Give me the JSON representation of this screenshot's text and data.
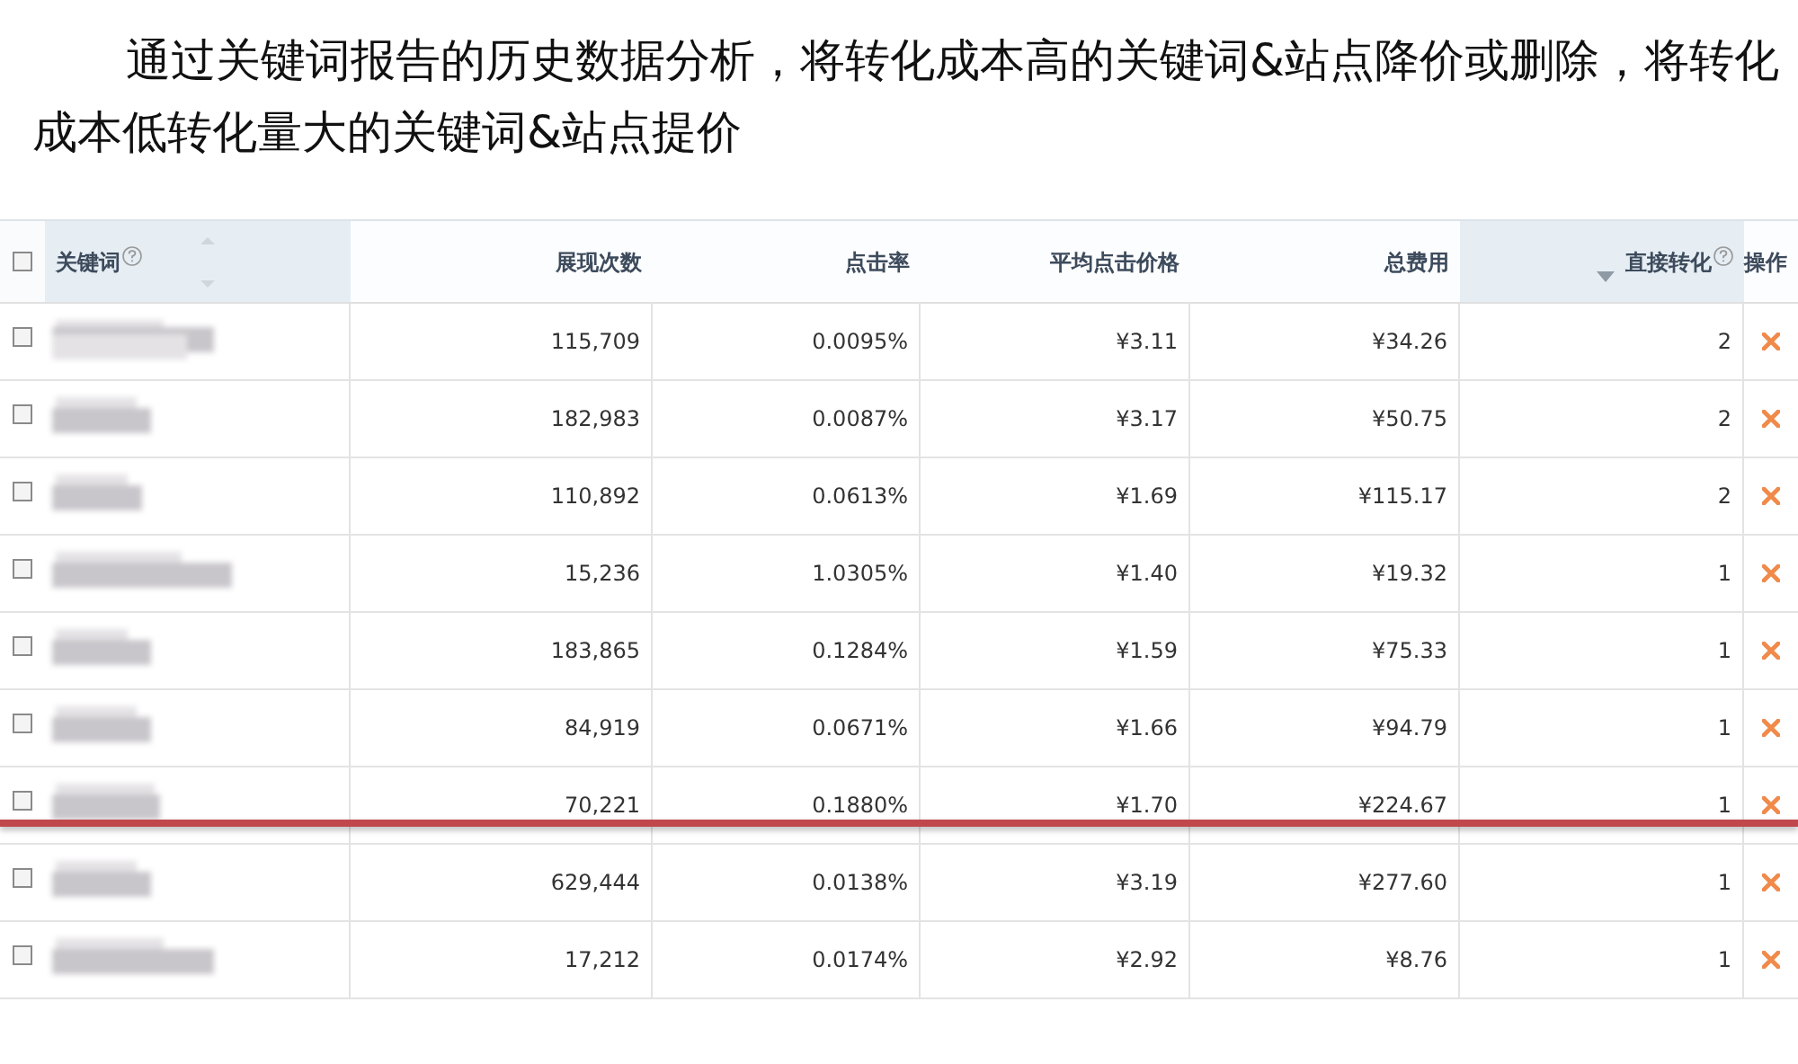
{
  "caption": "通过关键词报告的历史数据分析，将转化成本高的关键词&站点降价或删除，将转化成本低转化量大的关键词&站点提价",
  "table": {
    "select_all_checked": false,
    "columns": [
      {
        "label": "关键词",
        "help": true,
        "sortable": true,
        "sorted": false,
        "highlighted": true
      },
      {
        "label": "展现次数",
        "help": false,
        "sortable": false,
        "sorted": false,
        "highlighted": false
      },
      {
        "label": "点击率",
        "help": false,
        "sortable": false,
        "sorted": false,
        "highlighted": false
      },
      {
        "label": "平均点击价格",
        "help": false,
        "sortable": false,
        "sorted": false,
        "highlighted": false
      },
      {
        "label": "总费用",
        "help": false,
        "sortable": false,
        "sorted": false,
        "highlighted": false
      },
      {
        "label": "直接转化",
        "help": true,
        "sortable": false,
        "sorted": true,
        "highlighted": true
      },
      {
        "label": "操作",
        "help": false,
        "sortable": false,
        "sorted": false,
        "highlighted": false
      }
    ],
    "rows": [
      {
        "checked": false,
        "underlined": false,
        "cells": [
          "",
          "115,709",
          "0.0095%",
          "¥3.11",
          "¥34.26",
          "2"
        ]
      },
      {
        "checked": false,
        "underlined": false,
        "cells": [
          "",
          "182,983",
          "0.0087%",
          "¥3.17",
          "¥50.75",
          "2"
        ]
      },
      {
        "checked": false,
        "underlined": false,
        "cells": [
          "",
          "110,892",
          "0.0613%",
          "¥1.69",
          "¥115.17",
          "2"
        ]
      },
      {
        "checked": false,
        "underlined": false,
        "cells": [
          "",
          "15,236",
          "1.0305%",
          "¥1.40",
          "¥19.32",
          "1"
        ]
      },
      {
        "checked": false,
        "underlined": false,
        "cells": [
          "",
          "183,865",
          "0.1284%",
          "¥1.59",
          "¥75.33",
          "1"
        ]
      },
      {
        "checked": false,
        "underlined": false,
        "cells": [
          "",
          "84,919",
          "0.0671%",
          "¥1.66",
          "¥94.79",
          "1"
        ]
      },
      {
        "checked": false,
        "underlined": true,
        "cells": [
          "",
          "70,221",
          "0.1880%",
          "¥1.70",
          "¥224.67",
          "1"
        ]
      },
      {
        "checked": false,
        "underlined": false,
        "cells": [
          "",
          "629,444",
          "0.0138%",
          "¥3.19",
          "¥277.60",
          "1"
        ]
      },
      {
        "checked": false,
        "underlined": false,
        "cells": [
          "",
          "17,212",
          "0.0174%",
          "¥2.92",
          "¥8.76",
          "1"
        ]
      }
    ]
  }
}
